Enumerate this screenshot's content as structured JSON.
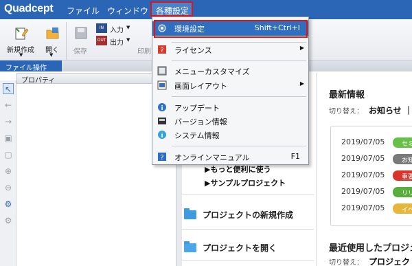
{
  "app": {
    "logo": "Quadcept"
  },
  "menubar": {
    "items": [
      "ファイル",
      "ウィンドウ"
    ],
    "active": "各種設定"
  },
  "ribbon": {
    "new_label": "新規作成",
    "open_label": "開く",
    "save_label": "保存",
    "input_label": "入力",
    "output_label": "出力",
    "print_label": "印刷",
    "group_label": "ファイル操作"
  },
  "property_panel": {
    "title": "プロパティ"
  },
  "dropdown": {
    "items": [
      {
        "label": "環境設定",
        "shortcut": "Shift+Ctrl+I",
        "icon": "gear-icon"
      },
      {
        "label": "ライセンス",
        "icon": "license-icon"
      },
      {
        "label": "メニューカスタマイズ",
        "icon": "customize-icon"
      },
      {
        "label": "画面レイアウト",
        "icon": "layout-icon"
      },
      {
        "label": "アップデート",
        "icon": "update-icon"
      },
      {
        "label": "バージョン情報",
        "icon": "version-icon"
      },
      {
        "label": "システム情報",
        "icon": "system-info-icon"
      },
      {
        "label": "オンラインマニュアル",
        "shortcut": "F1",
        "icon": "help-icon"
      }
    ]
  },
  "start": {
    "links": [
      "▶もっと便利に使う",
      "▶サンプルプロジェクト"
    ],
    "new_project": "プロジェクトの新規作成",
    "open_project": "プロジェクトを開く"
  },
  "news": {
    "title": "最新情報",
    "switch_label": "切り替え：",
    "switch_value": "お知らせ ｜",
    "rows": [
      {
        "date": "2019/07/05",
        "tag": "セミ",
        "color": "#6abf4b"
      },
      {
        "date": "2019/07/05",
        "tag": "お知",
        "color": "#7a7a7a"
      },
      {
        "date": "2019/07/05",
        "tag": "重要",
        "color": "#d9342b"
      },
      {
        "date": "2019/07/05",
        "tag": "リリ",
        "color": "#5aae3f"
      },
      {
        "date": "2019/07/05",
        "tag": "イベ",
        "color": "#e5b83d"
      }
    ]
  },
  "recent": {
    "title": "最近使用したプロジェ",
    "switch_label": "切り替え：",
    "switch_value": "プロジェク"
  }
}
